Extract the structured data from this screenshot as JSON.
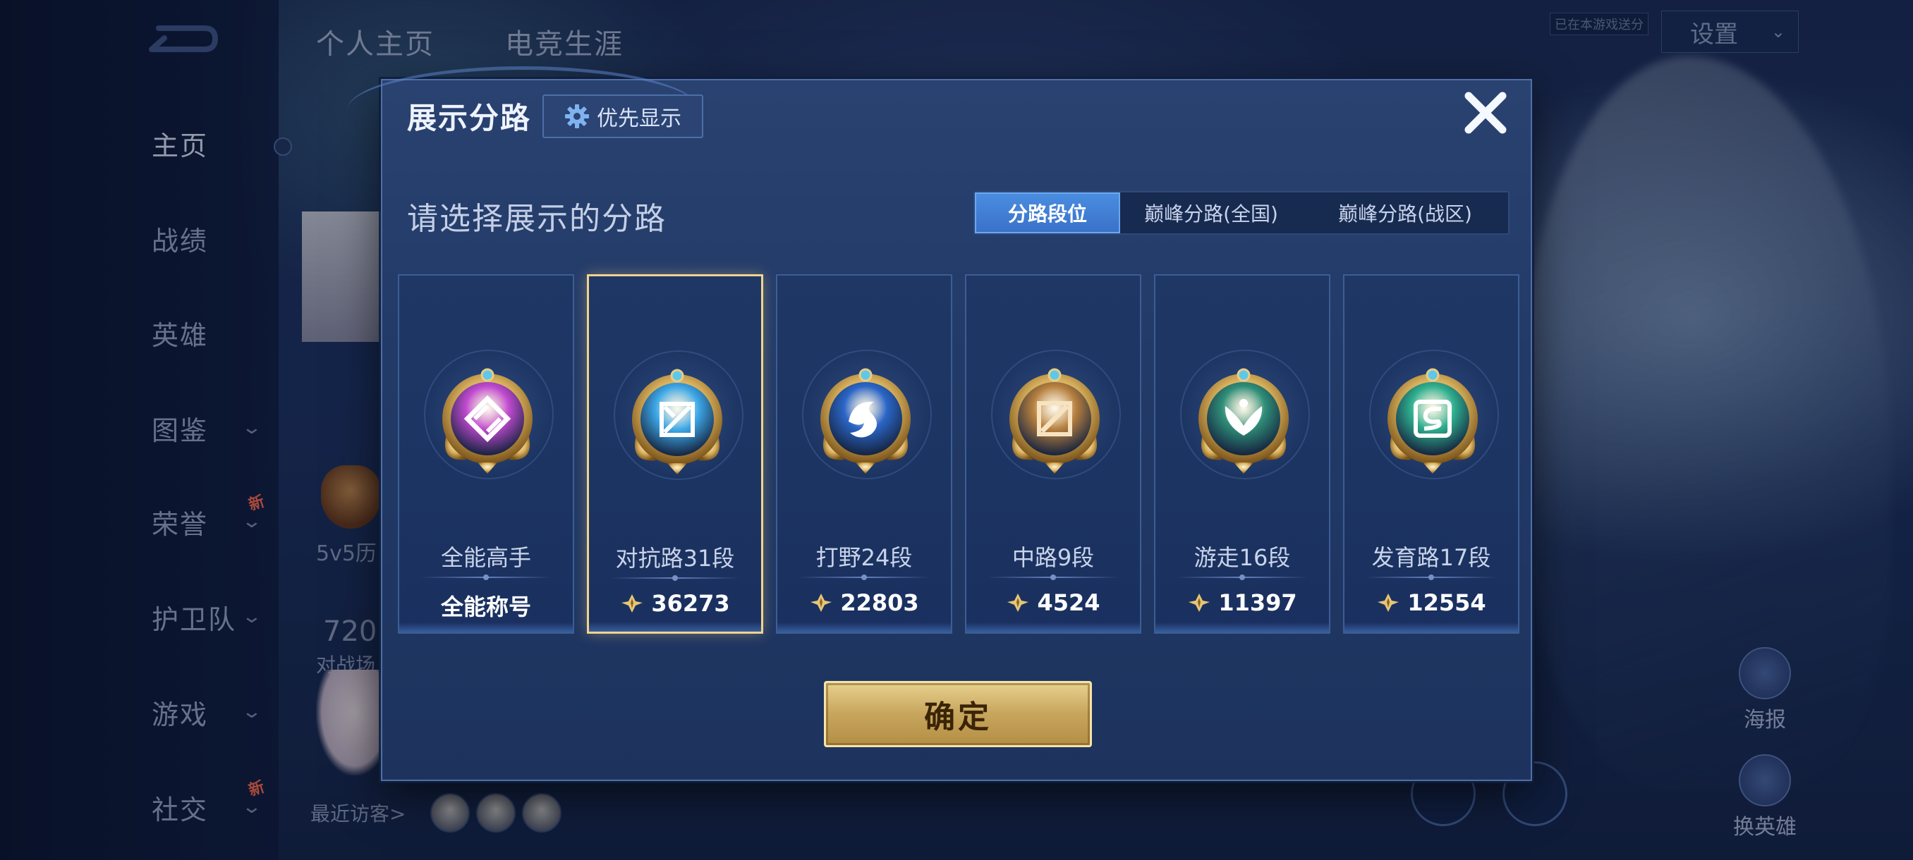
{
  "background": {
    "nav": [
      {
        "label": "主页",
        "active": true,
        "chevron": false,
        "badge": ""
      },
      {
        "label": "战绩",
        "active": false,
        "chevron": false,
        "badge": ""
      },
      {
        "label": "英雄",
        "active": false,
        "chevron": false,
        "badge": ""
      },
      {
        "label": "图鉴",
        "active": false,
        "chevron": true,
        "badge": ""
      },
      {
        "label": "荣誉",
        "active": false,
        "chevron": true,
        "badge": "新"
      },
      {
        "label": "护卫队",
        "active": false,
        "chevron": true,
        "badge": ""
      },
      {
        "label": "游戏",
        "active": false,
        "chevron": true,
        "badge": ""
      },
      {
        "label": "社交",
        "active": false,
        "chevron": true,
        "badge": "新"
      }
    ],
    "top_tabs": [
      "个人主页",
      "电竞生涯"
    ],
    "settings_label": "设置",
    "note_badge": "已在本游戏送分",
    "rank_caption": "5v5历",
    "stat_number": "720",
    "stat_caption": "对战场",
    "recent_visitors": "最近访客>",
    "right_actions": [
      "海报",
      "换英雄"
    ]
  },
  "modal": {
    "title": "展示分路",
    "priority_button": "优先显示",
    "subtitle": "请选择展示的分路",
    "tabs": [
      "分路段位",
      "巅峰分路(全国)",
      "巅峰分路(战区)"
    ],
    "active_tab": 0,
    "cards": [
      {
        "name": "全能高手",
        "value": "全能称号",
        "show_icon": false,
        "color": "#c04ad0",
        "selected": false,
        "icon": "all-round-emblem-icon"
      },
      {
        "name": "对抗路31段",
        "value": "36273",
        "show_icon": true,
        "color": "#3da8e8",
        "selected": true,
        "icon": "clash-lane-emblem-icon"
      },
      {
        "name": "打野24段",
        "value": "22803",
        "show_icon": true,
        "color": "#2b66c8",
        "selected": false,
        "icon": "jungle-emblem-icon"
      },
      {
        "name": "中路9段",
        "value": "4524",
        "show_icon": true,
        "color": "#b7803f",
        "selected": false,
        "icon": "mid-lane-emblem-icon"
      },
      {
        "name": "游走16段",
        "value": "11397",
        "show_icon": true,
        "color": "#2f8e78",
        "selected": false,
        "icon": "roam-emblem-icon"
      },
      {
        "name": "发育路17段",
        "value": "12554",
        "show_icon": true,
        "color": "#2fb08f",
        "selected": false,
        "icon": "farm-lane-emblem-icon"
      }
    ],
    "confirm_button": "确定"
  }
}
